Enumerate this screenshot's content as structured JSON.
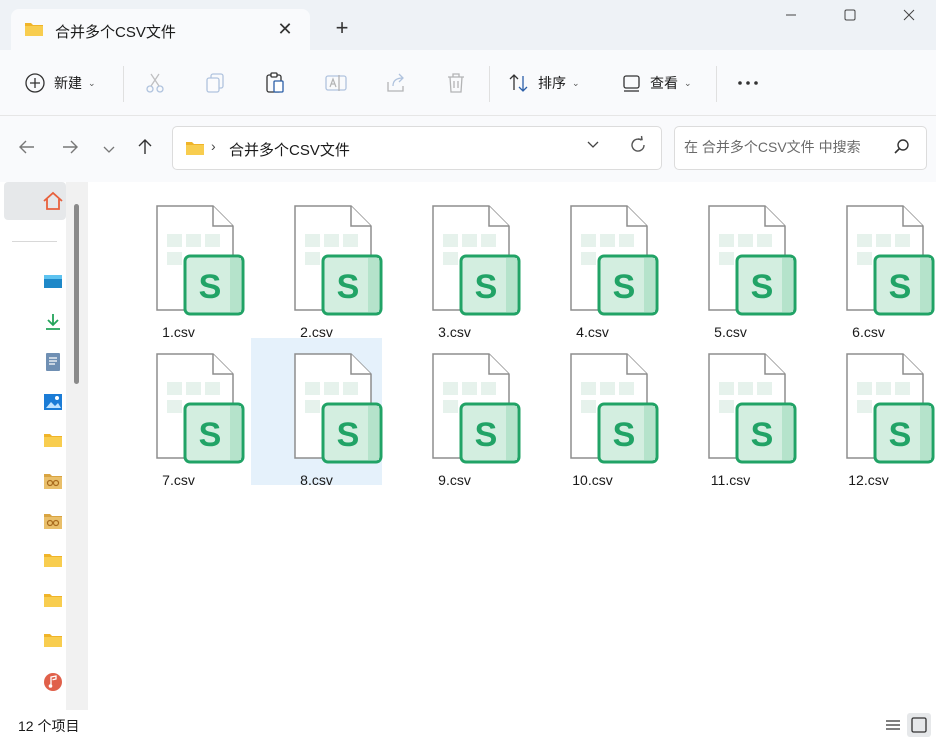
{
  "window": {
    "tab_title": "合并多个CSV文件",
    "tab_close": "✕",
    "new_tab": "+",
    "controls": {
      "minimize": "—",
      "maximize": "▢",
      "close": "✕"
    }
  },
  "toolbar": {
    "new_label": "新建",
    "sort_label": "排序",
    "view_label": "查看",
    "more_label": "···"
  },
  "address": {
    "path": "合并多个CSV文件",
    "search_placeholder": "在 合并多个CSV文件 中搜索"
  },
  "files": [
    {
      "name": "1.csv",
      "selected": false
    },
    {
      "name": "2.csv",
      "selected": false
    },
    {
      "name": "3.csv",
      "selected": false
    },
    {
      "name": "4.csv",
      "selected": false
    },
    {
      "name": "5.csv",
      "selected": false
    },
    {
      "name": "6.csv",
      "selected": false
    },
    {
      "name": "7.csv",
      "selected": false
    },
    {
      "name": "8.csv",
      "selected": true
    },
    {
      "name": "9.csv",
      "selected": false
    },
    {
      "name": "10.csv",
      "selected": false
    },
    {
      "name": "11.csv",
      "selected": false
    },
    {
      "name": "12.csv",
      "selected": false
    }
  ],
  "file_icon_letter": "S",
  "sidebar": {
    "items": [
      {
        "icon": "desktop-icon"
      },
      {
        "icon": "downloads-icon"
      },
      {
        "icon": "documents-icon"
      },
      {
        "icon": "pictures-icon"
      },
      {
        "icon": "folder-icon"
      },
      {
        "icon": "zip-folder-icon"
      },
      {
        "icon": "zip-folder-icon"
      },
      {
        "icon": "folder-icon"
      },
      {
        "icon": "folder-icon"
      },
      {
        "icon": "folder-icon"
      },
      {
        "icon": "music-icon"
      }
    ]
  },
  "status": {
    "item_count": "12 个项目"
  },
  "colors": {
    "accent_green": "#21a366",
    "selection": "#e5f1fb",
    "folder": "#f5c542"
  }
}
